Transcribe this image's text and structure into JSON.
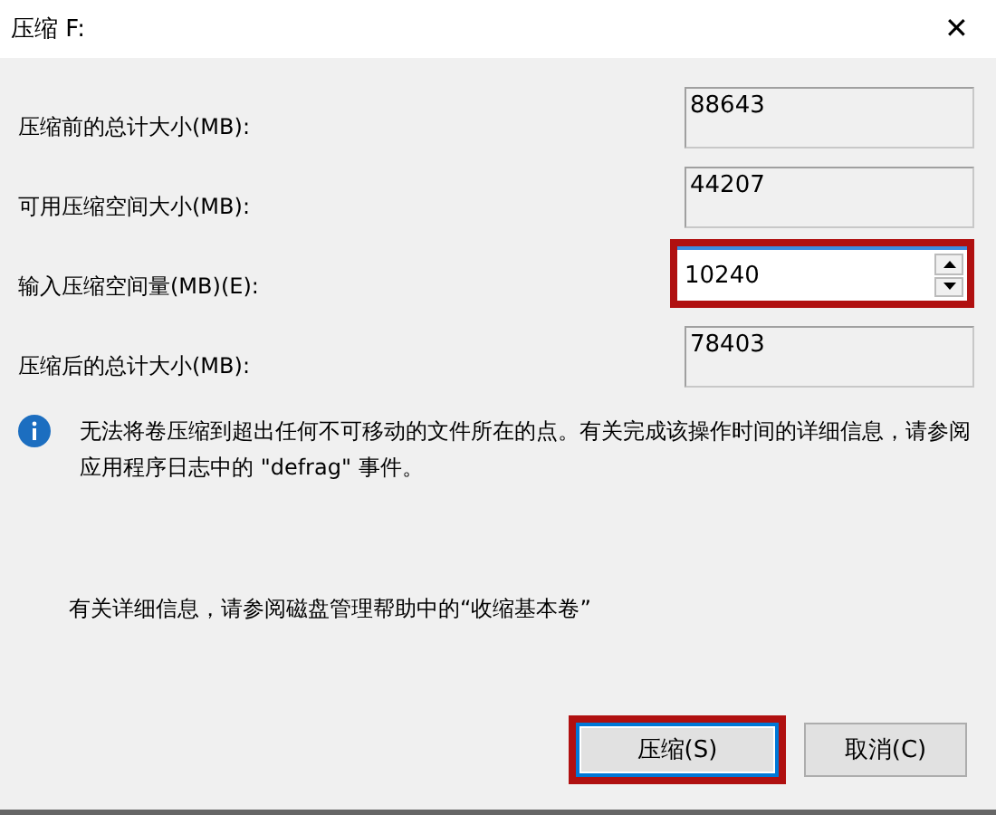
{
  "window": {
    "title": "压缩 F:",
    "close": "✕"
  },
  "fields": [
    {
      "label": "压缩前的总计大小(MB):",
      "value": "88643",
      "kind": "readonly"
    },
    {
      "label": "可用压缩空间大小(MB):",
      "value": "44207",
      "kind": "readonly"
    },
    {
      "label": "输入压缩空间量(MB)(E):",
      "value": "10240",
      "kind": "spin",
      "highlighted": true
    },
    {
      "label": "压缩后的总计大小(MB):",
      "value": "78403",
      "kind": "readonly"
    }
  ],
  "info": "无法将卷压缩到超出任何不可移动的文件所在的点。有关完成该操作时间的详细信息，请参阅应用程序日志中的 \"defrag\" 事件。",
  "help": "有关详细信息，请参阅磁盘管理帮助中的“收缩基本卷”",
  "buttons": [
    {
      "label": "压缩(S)",
      "default": true,
      "highlighted": true
    },
    {
      "label": "取消(C)",
      "default": false,
      "highlighted": false
    }
  ]
}
